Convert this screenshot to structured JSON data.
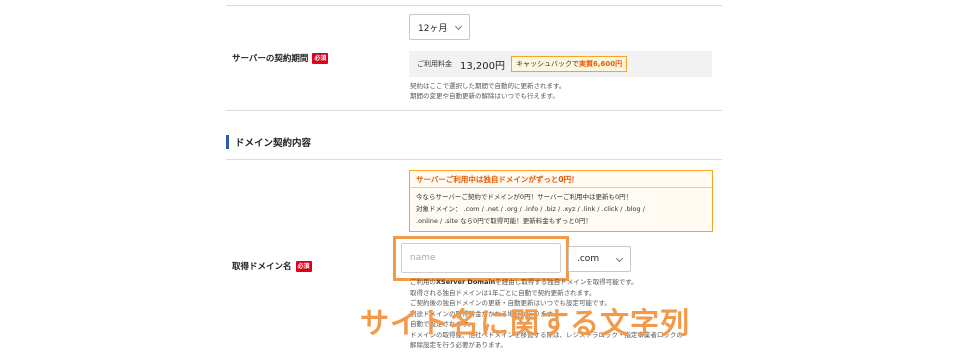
{
  "contract": {
    "label": "サーバーの契約期間",
    "required_badge": "必須",
    "period_value": "12ヶ月",
    "price_label": "ご利用料金",
    "price_value": "13,200円",
    "cashback_prefix": "キャッシュバックで",
    "cashback_amount": "実質6,600円",
    "note_line1": "契約はここで選択した期間で自動的に更新されます。",
    "note_line2": "期間の変更や自動更新の解除はいつでも行えます。"
  },
  "domain_section": {
    "title": "ドメイン契約内容"
  },
  "promo": {
    "headline": "サーバーご利用中は独自ドメインがずっと0円！",
    "line1": "今ならサーバーご契約でドメインが0円！サーバーご利用中は更新も0円！",
    "line2": "対象ドメイン： .com / .net / .org / .info / .biz / .xyz / .link / .click / .blog /",
    "line3": ".online / .site なら0円で取得可能！更新料金もずっと0円！"
  },
  "domain_name": {
    "label": "取得ドメイン名",
    "required_badge": "必須",
    "input_placeholder": "name",
    "tld_value": ".com",
    "desc_prefix": "ご利用の",
    "desc_brand": "XServer Domain",
    "desc_suffix": "を経由し取得する独自ドメインを取得可能です。",
    "desc_line2": "取得される独自ドメインは1年ごとに自動で契約更新されます。",
    "desc_line3": "ご契約後の独自ドメインの更新・自動更新はいつでも設定可能です。",
    "desc_line4": "別途ドメインの取得料金がかかる場合があります。",
    "desc_line5": "自動で設定されます。",
    "desc_line6": "ドメインの取得後、他社へドメインを移管する際は、レジストラロック・指定事業者ロックの",
    "desc_line7": "解除設定を行う必要があります。"
  },
  "annotation": {
    "caption": "サイト名に関する文字列"
  }
}
